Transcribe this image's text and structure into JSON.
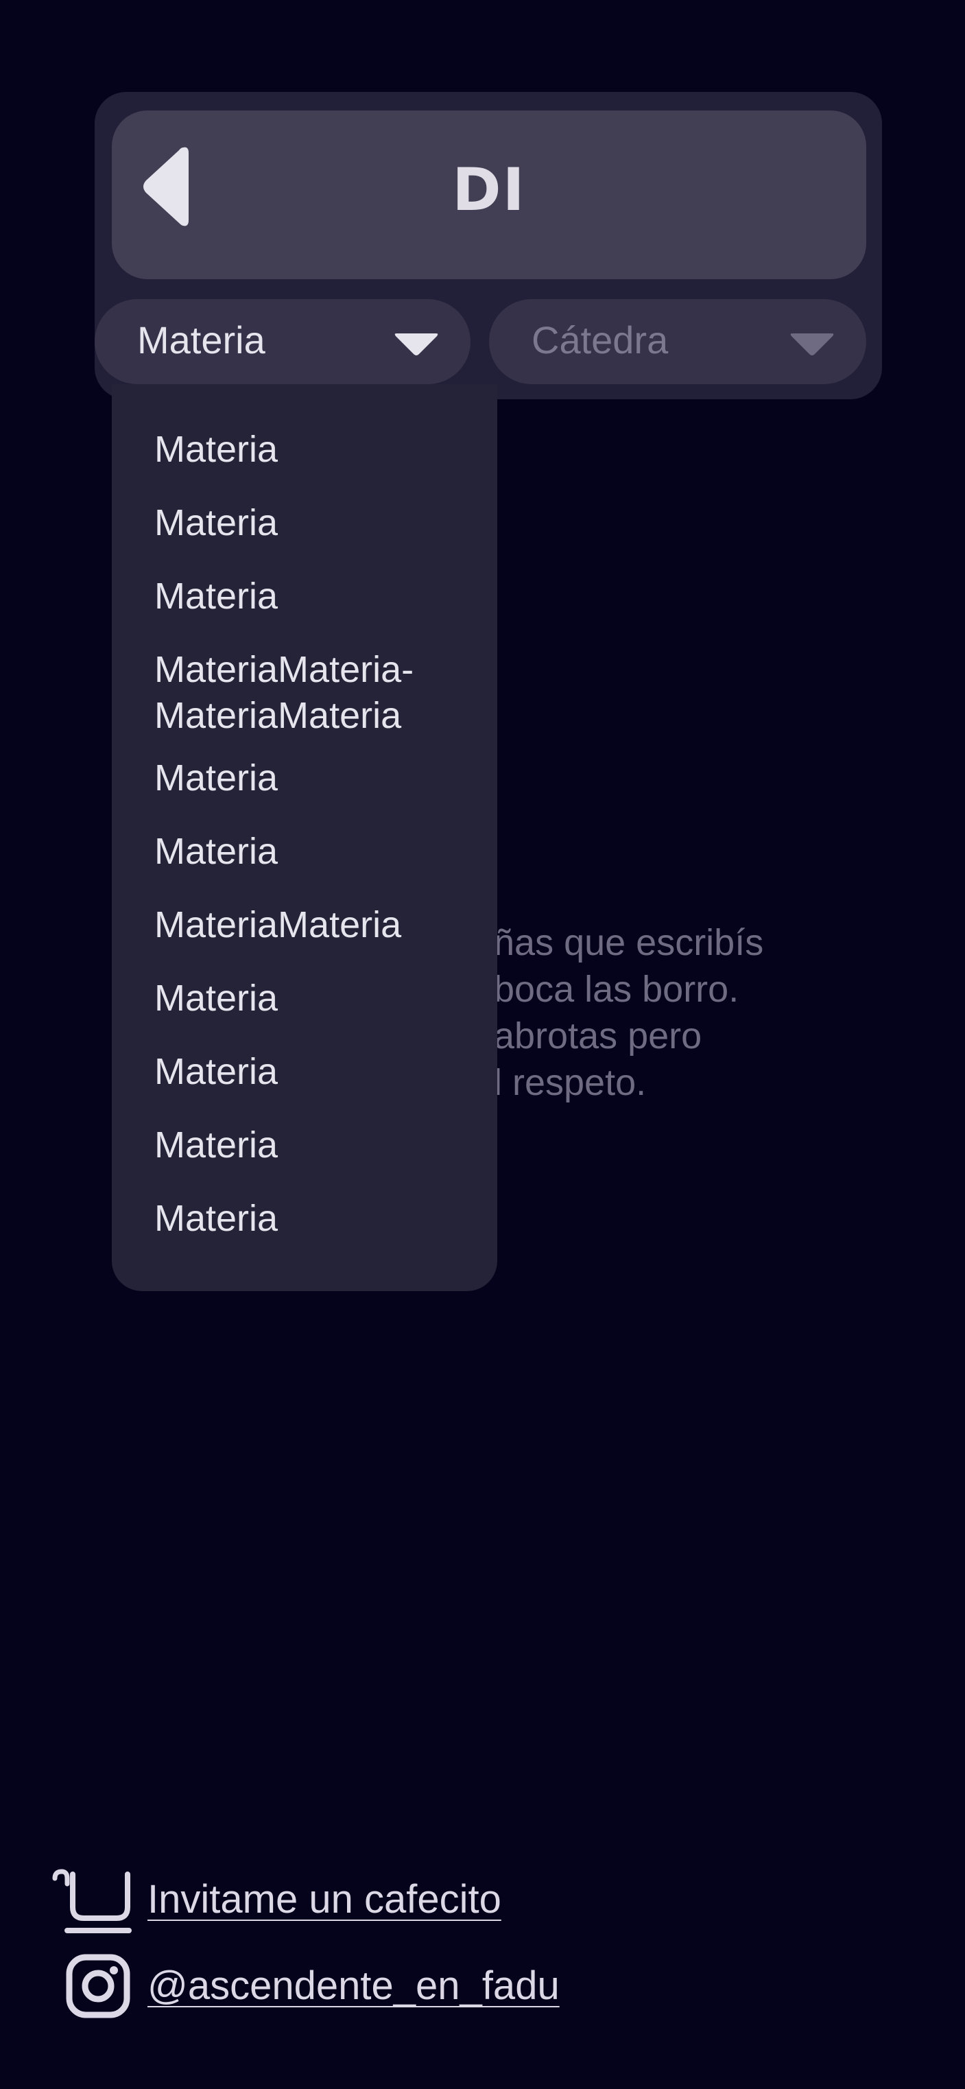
{
  "header": {
    "title": "DI",
    "back_icon": "back-arrow-icon"
  },
  "filters": {
    "materia": {
      "value": "Materia",
      "icon": "chevron-down-icon"
    },
    "catedra": {
      "placeholder": "Cátedra",
      "icon": "chevron-down-icon"
    }
  },
  "dropdown": {
    "items": [
      "Materia",
      "Materia",
      "Materia",
      "MateriaMateria-\nMateriaMateria",
      "Materia",
      "Materia",
      "MateriaMateria",
      "Materia",
      "Materia",
      "Materia",
      "Materia"
    ]
  },
  "background_note": {
    "lines": [
      "ñas que escribís",
      "boca las borro.",
      "abrotas pero",
      "l respeto."
    ]
  },
  "footer": {
    "cafecito": {
      "label": "Invitame un cafecito",
      "icon": "cup-icon"
    },
    "instagram": {
      "label": "@ascendente_en_fadu",
      "icon": "instagram-icon"
    }
  },
  "colors": {
    "background": "#05021c",
    "panel": "#221f38",
    "title_bar": "#423e54",
    "select": "#363249",
    "dropdown": "#252338",
    "text": "#e6e4ec",
    "muted": "#7c7890"
  }
}
